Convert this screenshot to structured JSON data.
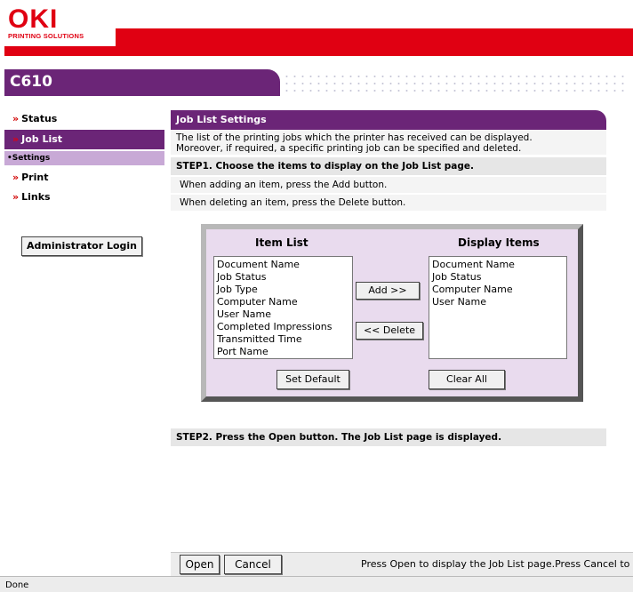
{
  "header": {
    "brand": "OKI",
    "brand_tagline": "PRINTING SOLUTIONS",
    "model": "C610",
    "brand_color": "#e00012",
    "accent_color": "#6b2577"
  },
  "sidebar": {
    "arrow": "»",
    "items": [
      {
        "label": "Status"
      },
      {
        "label": "Job List"
      },
      {
        "label": "Print"
      },
      {
        "label": "Links"
      }
    ],
    "sub_item": "•Settings",
    "admin_button": "Administrator Login"
  },
  "main": {
    "title": "Job List Settings",
    "description_line1": "The list of the printing jobs which the printer has received can be displayed.",
    "description_line2": "Moreover, if required, a specific printing job can be specified and deleted.",
    "step1": "STEP1. Choose the items to display on the Job List page.",
    "hint_add": "When adding an item, press the Add button.",
    "hint_delete": "When deleting an item, press the Delete button.",
    "item_list_title": "Item List",
    "display_items_title": "Display Items",
    "item_list": [
      "Document Name",
      "Job Status",
      "Job Type",
      "Computer Name",
      "User Name",
      "Completed Impressions",
      "Transmitted Time",
      "Port Name"
    ],
    "display_items": [
      "Document Name",
      "Job Status",
      "Computer Name",
      "User Name"
    ],
    "add_button": "Add >>",
    "delete_button": "<< Delete",
    "set_default_button": "Set Default",
    "clear_all_button": "Clear All",
    "step2": "STEP2. Press the Open button. The Job List page is displayed."
  },
  "footer": {
    "open_button": "Open",
    "cancel_button": "Cancel",
    "message": "Press Open to display the Job List page.Press Cancel to"
  },
  "statusbar": {
    "text": "Done"
  }
}
